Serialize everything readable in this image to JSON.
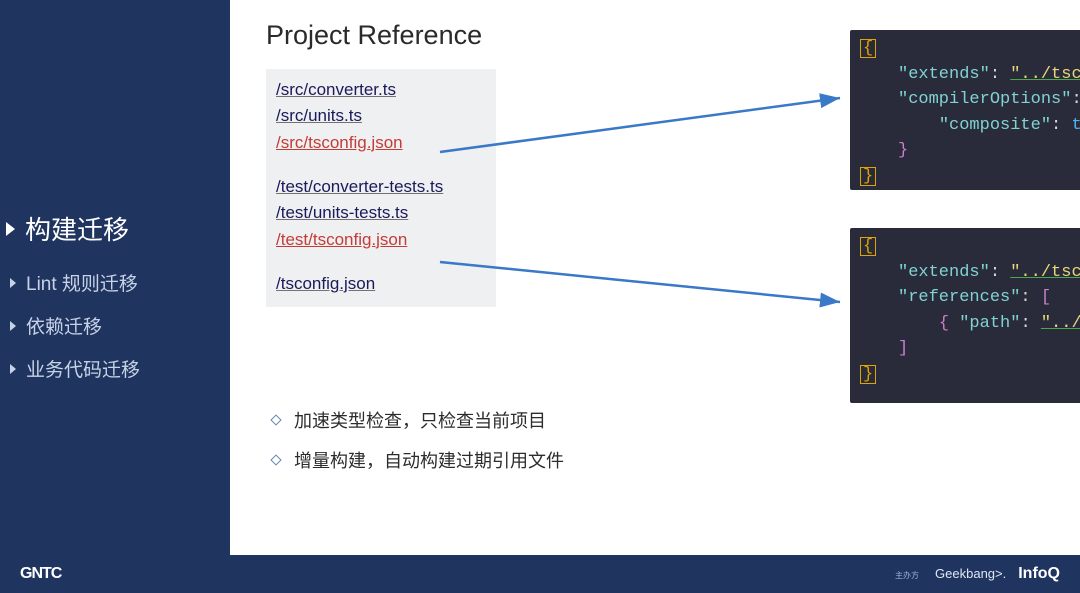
{
  "sidebar": {
    "items": [
      {
        "label": "构建迁移",
        "active": true
      },
      {
        "label": "Lint 规则迁移",
        "active": false
      },
      {
        "label": "依赖迁移",
        "active": false
      },
      {
        "label": "业务代码迁移",
        "active": false
      }
    ]
  },
  "main": {
    "title": "Project Reference",
    "files": [
      {
        "text": "/src/converter.ts",
        "hl": false
      },
      {
        "text": "/src/units.ts",
        "hl": false
      },
      {
        "text": "/src/tsconfig.json",
        "hl": true
      },
      {
        "gap": true
      },
      {
        "text": "/test/converter-tests.ts",
        "hl": false
      },
      {
        "text": "/test/units-tests.ts",
        "hl": false
      },
      {
        "text": "/test/tsconfig.json",
        "hl": true
      },
      {
        "gap": true
      },
      {
        "text": "/tsconfig.json",
        "hl": false
      }
    ],
    "code1": {
      "extends_key": "\"extends\"",
      "extends_val": "\"../tsconfig\"",
      "compilerOptions_key": "\"compilerOptions\"",
      "composite_key": "\"composite\"",
      "composite_val": "true"
    },
    "code2": {
      "extends_key": "\"extends\"",
      "extends_val": "\"../tsconfig\"",
      "references_key": "\"references\"",
      "path_key": "\"path\"",
      "path_val": "\"../src\""
    },
    "bullets": [
      "加速类型检查，只检查当前项目",
      "增量构建，自动构建过期引用文件"
    ]
  },
  "footer": {
    "left": "GNTC",
    "tiny": "主办方",
    "geekbang": "Geekbang>.",
    "infoq": "InfoQ"
  }
}
